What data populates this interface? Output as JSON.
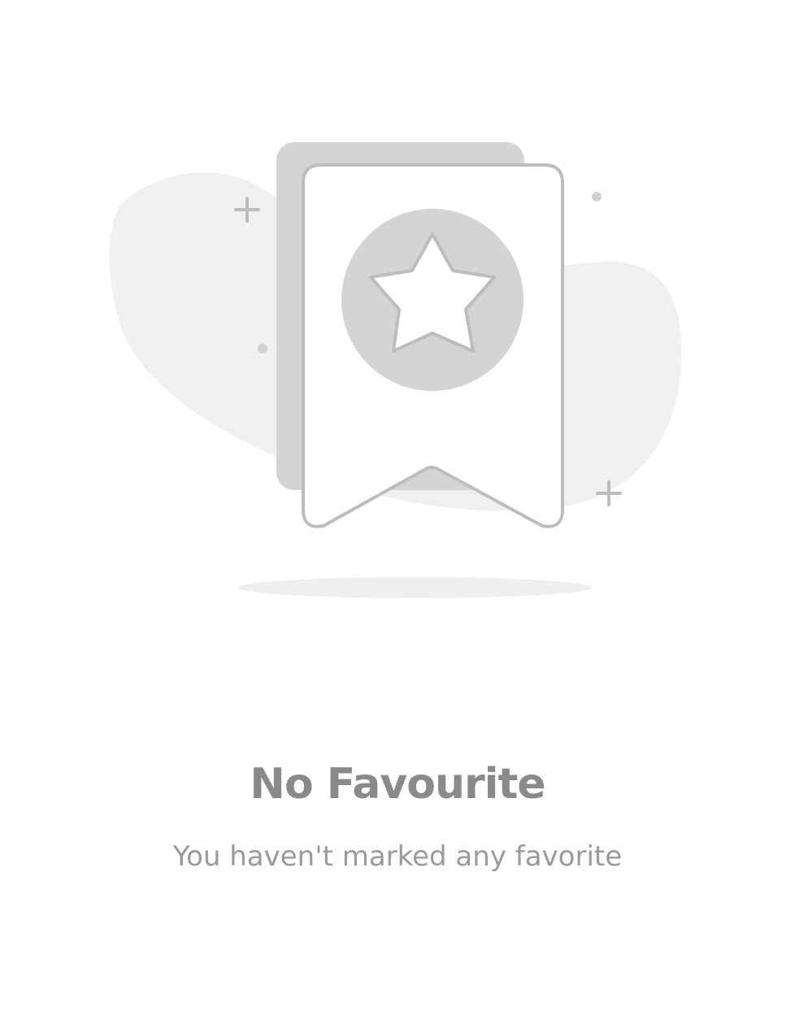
{
  "empty_state": {
    "title": "No Favourite",
    "subtitle": "You haven't marked any favorite",
    "illustration_icon": "bookmark-star-icon"
  },
  "colors": {
    "background": "#ffffff",
    "blob": "#f0f0f0",
    "card_shadow": "#d4d4d4",
    "stroke": "#bdbdbd",
    "title_text": "#8a8a8a",
    "subtitle_text": "#9a9a9a"
  }
}
